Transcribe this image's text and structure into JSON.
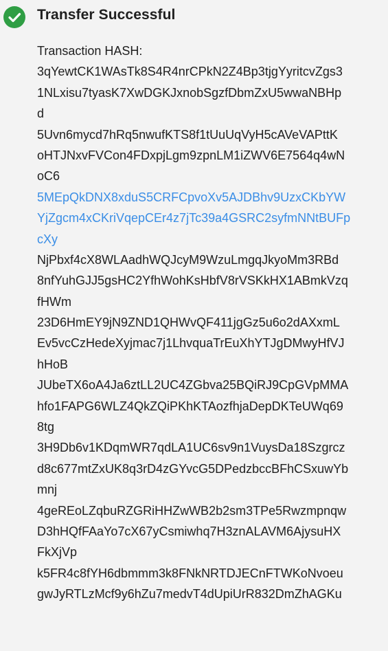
{
  "notification": {
    "icon": "check-circle-icon",
    "title": "Transfer Successful",
    "label": "Transaction HASH:",
    "colors": {
      "success": "#2f9e44",
      "link": "#3b8ee6",
      "text": "#1f1f1f",
      "background": "#f3f3f3"
    }
  },
  "hashes": [
    {
      "lines": [
        "3qYewtCK1WAsTk8S4R4nrCPkN2Z4Bp3tjgYyritcvZgs3",
        "1NLxisu7tyasK7XwDGKJxnobSgzfDbmZxU5wwaNBHp",
        "d"
      ],
      "highlighted": false
    },
    {
      "lines": [
        "5Uvn6mycd7hRq5nwufKTS8f1tUuUqVyH5cAVeVAPttK",
        "oHTJNxvFVCon4FDxpjLgm9zpnLM1iZWV6E7564q4wN",
        "oC6"
      ],
      "highlighted": false
    },
    {
      "lines": [
        "5MEpQkDNX8xduS5CRFCpvoXv5AJDBhv9UzxCKbYW",
        "YjZgcm4xCKriVqepCEr4z7jTc39a4GSRC2syfmNNtBUFp",
        "cXy"
      ],
      "highlighted": true
    },
    {
      "lines": [
        "NjPbxf4cX8WLAadhWQJcyM9WzuLmgqJkyoMm3RBd",
        "8nfYuhGJJ5gsHC2YfhWohKsHbfV8rVSKkHX1ABmkVzq",
        "fHWm"
      ],
      "highlighted": false
    },
    {
      "lines": [
        "23D6HmEY9jN9ZND1QHWvQF411jgGz5u6o2dAXxmL",
        "Ev5vcCzHedeXyjmac7j1LhvquaTrEuXhYTJgDMwyHfVJ",
        "hHoB"
      ],
      "highlighted": false
    },
    {
      "lines": [
        "JUbeTX6oA4Ja6ztLL2UC4ZGbva25BQiRJ9CpGVpMMA",
        "hfo1FAPG6WLZ4QkZQiPKhKTAozfhjaDepDKTeUWq69",
        "8tg"
      ],
      "highlighted": false
    },
    {
      "lines": [
        "3H9Db6v1KDqmWR7qdLA1UC6sv9n1VuysDa18Szgrcz",
        "d8c677mtZxUK8q3rD4zGYvcG5DPedzbccBFhCSxuwYb",
        "mnj"
      ],
      "highlighted": false
    },
    {
      "lines": [
        "4geREoLZqbuRZGRiHHZwWB2b2sm3TPe5Rwzmpnqw",
        "D3hHQfFAaYo7cX67yCsmiwhq7H3znALAVM6AjysuHX",
        "FkXjVp"
      ],
      "highlighted": false
    },
    {
      "lines": [
        "k5FR4c8fYH6dbmmm3k8FNkNRTDJECnFTWKoNvoeu",
        "gwJyRTLzMcf9y6hZu7medvT4dUpiUrR832DmZhAGKu"
      ],
      "highlighted": false
    }
  ]
}
